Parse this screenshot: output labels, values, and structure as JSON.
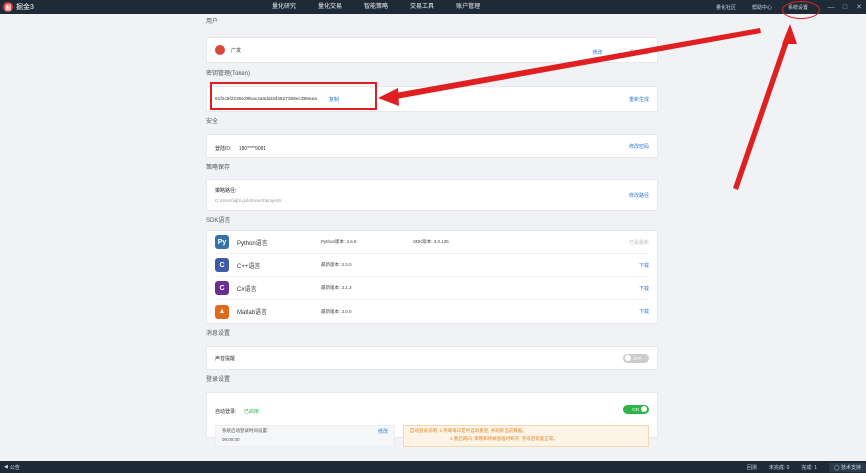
{
  "titlebar": {
    "app_name": "掘金3",
    "nav": [
      "量化研究",
      "量化交易",
      "智能策略",
      "交易工具",
      "账户管理"
    ],
    "right_links": [
      "量化社区",
      "帮助中心",
      "系统设置"
    ],
    "window_controls": [
      "—",
      "□",
      "✕"
    ]
  },
  "user": {
    "section": "用户",
    "name": "广发",
    "edit_label": "修改",
    "logout_label": "退出登录"
  },
  "token": {
    "section": "密钥管理(Token)",
    "value": "61f2c5f2230e29bac2a0dd18f3527359ec386eea",
    "copy_label": "复制",
    "regen_label": "重新生成"
  },
  "security": {
    "section": "安全",
    "login_id_label": "登陆ID:",
    "login_id_value": "180****9081",
    "change_pwd_label": "修改密码"
  },
  "strategy": {
    "section": "策略保存",
    "path_label": "策略路径:",
    "path_value": "C:\\Users\\ajh\\.goldminer3\\projects",
    "change_path_label": "修改路径"
  },
  "sdk": {
    "section": "SDK语言",
    "items": [
      {
        "name": "Python语言",
        "ver1": "Python版本: 3.6.8",
        "ver2": "SDK版本: 3.0.135",
        "action": "已是最新",
        "icon": "python-icon",
        "color": "#3572A5",
        "glyph": "Py"
      },
      {
        "name": "C++语言",
        "ver1": "最新版本: 3.3.0",
        "ver2": "",
        "action": "下载",
        "icon": "cpp-icon",
        "color": "#3f5aa8",
        "glyph": "C"
      },
      {
        "name": "C#语言",
        "ver1": "最新版本: 3.1.3",
        "ver2": "",
        "action": "下载",
        "icon": "csharp-icon",
        "color": "#6a2d91",
        "glyph": "C"
      },
      {
        "name": "Matlab语言",
        "ver1": "最新版本: 3.0.0",
        "ver2": "",
        "action": "下载",
        "icon": "matlab-icon",
        "color": "#e06a1a",
        "glyph": "▲"
      }
    ]
  },
  "message": {
    "section": "消息设置",
    "sound_label": "声音提醒",
    "sound_toggle": "OFF"
  },
  "login": {
    "section": "登录设置",
    "auto_label": "自动登录:",
    "auto_status": "已启用",
    "auto_toggle": "ON",
    "schedule_label": "系统启动登录时间设置:",
    "schedule_time": "09:00:00",
    "schedule_edit": "修改",
    "note_line1": "自动登录说明: 1.终端每日定时自动重登, 并刷新当前数据。",
    "note_line2": "2.重启期间, 策略和终端会临时断开, 完成后恢复正常。"
  },
  "statusbar": {
    "notice": "公告",
    "items": [
      "回测",
      "未完成: 0",
      "完成: 1"
    ],
    "support": "技术支持"
  },
  "colors": {
    "titlebar": "#1f2a37",
    "accent": "#2f7bd8",
    "toggle_on": "#2fb44a",
    "toggle_off": "#cccccc",
    "highlight": "#e02020"
  }
}
